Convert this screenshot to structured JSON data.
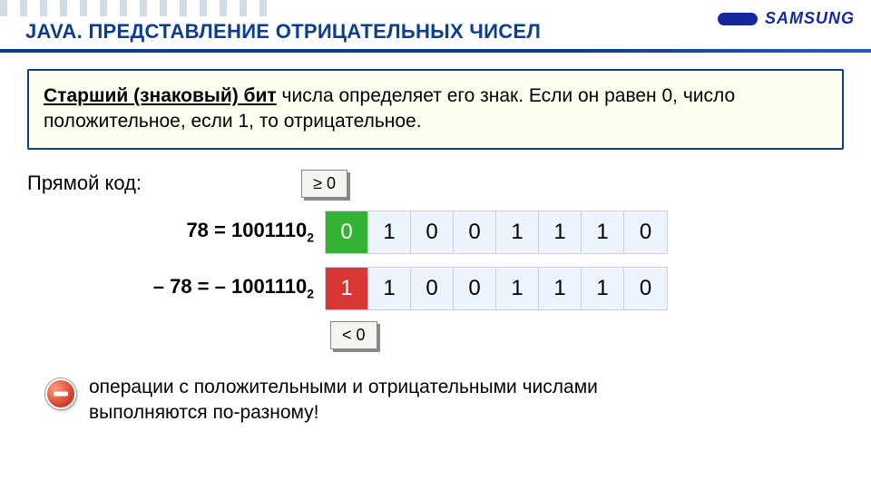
{
  "header": {
    "title": "JAVA. ПРЕДСТАВЛЕНИЕ ОТРИЦАТЕЛЬНЫХ ЧИСЕЛ",
    "logo_text": "SAMSUNG"
  },
  "definition": {
    "term": "Старший (знаковый) бит",
    "rest": " числа определяет его знак. Если он равен 0, число положительное, если 1, то отрицательное."
  },
  "direct_code_label": "Прямой код:",
  "badge_pos": "≥ 0",
  "badge_neg": "< 0",
  "rows": [
    {
      "label_prefix": "78 = 1001110",
      "label_sub": "2",
      "bits": [
        "0",
        "1",
        "0",
        "0",
        "1",
        "1",
        "1",
        "0"
      ],
      "sign_class": "bit-sign-green"
    },
    {
      "label_prefix": "– 78 = – 1001110",
      "label_sub": "2",
      "bits": [
        "1",
        "1",
        "0",
        "0",
        "1",
        "1",
        "1",
        "0"
      ],
      "sign_class": "bit-sign-red"
    }
  ],
  "warning": "операции с положительными и отрицательными числами выполняются по-разному!"
}
